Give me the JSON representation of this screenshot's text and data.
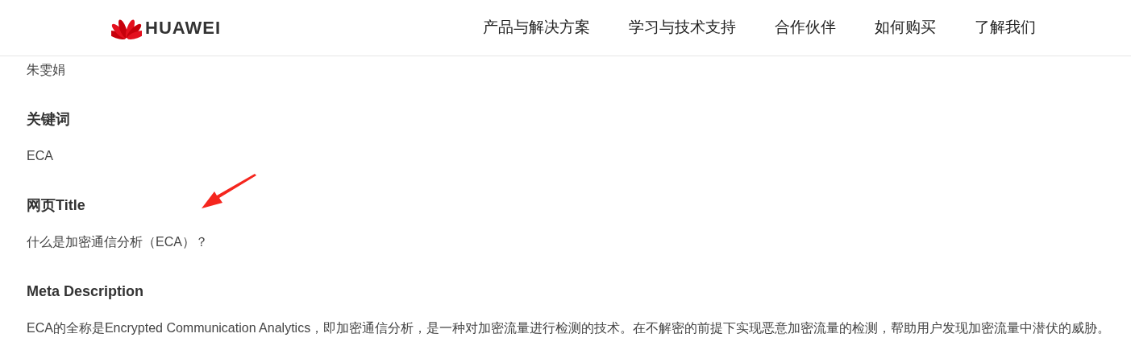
{
  "header": {
    "logo_text": "HUAWEI",
    "nav": [
      {
        "label": "产品与解决方案"
      },
      {
        "label": "学习与技术支持"
      },
      {
        "label": "合作伙伴"
      },
      {
        "label": "如何购买"
      },
      {
        "label": "了解我们"
      }
    ]
  },
  "sections": [
    {
      "value": "朱雯娟"
    },
    {
      "heading": "关键词",
      "value": "ECA"
    },
    {
      "heading": "网页Title",
      "value": "什么是加密通信分析（ECA）？"
    },
    {
      "heading": "Meta Description",
      "value": "ECA的全称是Encrypted Communication Analytics，即加密通信分析，是一种对加密流量进行检测的技术。在不解密的前提下实现恶意加密流量的检测，帮助用户发现加密流量中潜伏的威胁。"
    }
  ]
}
